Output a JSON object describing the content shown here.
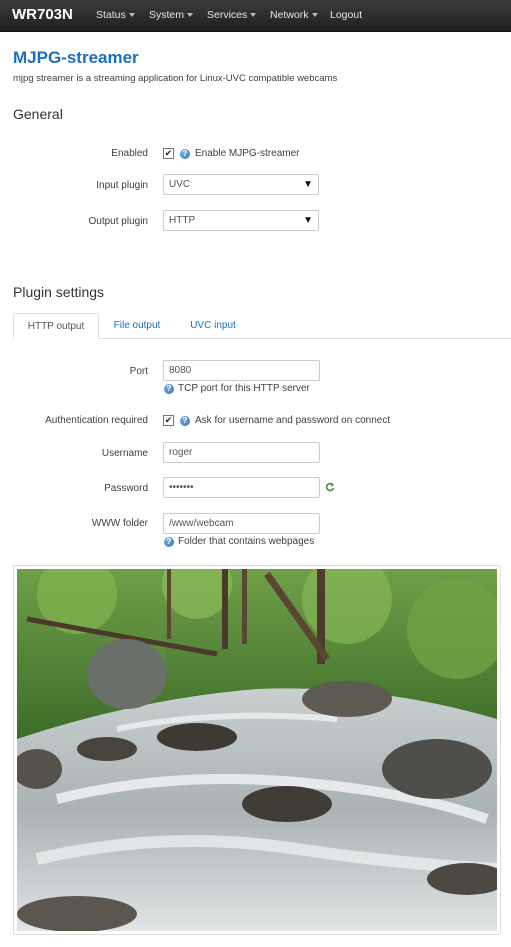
{
  "navbar": {
    "brand": "WR703N",
    "items": [
      {
        "label": "Status",
        "dropdown": true
      },
      {
        "label": "System",
        "dropdown": true
      },
      {
        "label": "Services",
        "dropdown": true
      },
      {
        "label": "Network",
        "dropdown": true
      },
      {
        "label": "Logout",
        "dropdown": false
      }
    ]
  },
  "page": {
    "title": "MJPG-streamer",
    "description": "mjpg streamer is a streaming application for Linux-UVC compatible webcams"
  },
  "general": {
    "title": "General",
    "enabled": {
      "label": "Enabled",
      "checked": true,
      "text": "Enable MJPG-streamer"
    },
    "input_plugin": {
      "label": "Input plugin",
      "value": "UVC"
    },
    "output_plugin": {
      "label": "Output plugin",
      "value": "HTTP"
    }
  },
  "plugin_settings": {
    "title": "Plugin settings",
    "tabs": [
      {
        "label": "HTTP output",
        "active": true
      },
      {
        "label": "File output",
        "active": false
      },
      {
        "label": "UVC input",
        "active": false
      }
    ],
    "port": {
      "label": "Port",
      "value": "8080",
      "help": "TCP port for this HTTP server"
    },
    "auth": {
      "label": "Authentication required",
      "checked": true,
      "text": "Ask for username and password on connect"
    },
    "username": {
      "label": "Username",
      "value": "roger"
    },
    "password": {
      "label": "Password",
      "value": "roger12"
    },
    "www_folder": {
      "label": "WWW folder",
      "value": "/www/webcam",
      "help": "Folder that contains webpages"
    }
  },
  "colors": {
    "accent": "#1a6fc4",
    "navbar": "#2b2b2b",
    "help_icon": "#2d6fb5"
  },
  "icons": {
    "help": "question-circle-icon",
    "reveal": "refresh-icon",
    "checkbox": "checkmark-icon"
  }
}
